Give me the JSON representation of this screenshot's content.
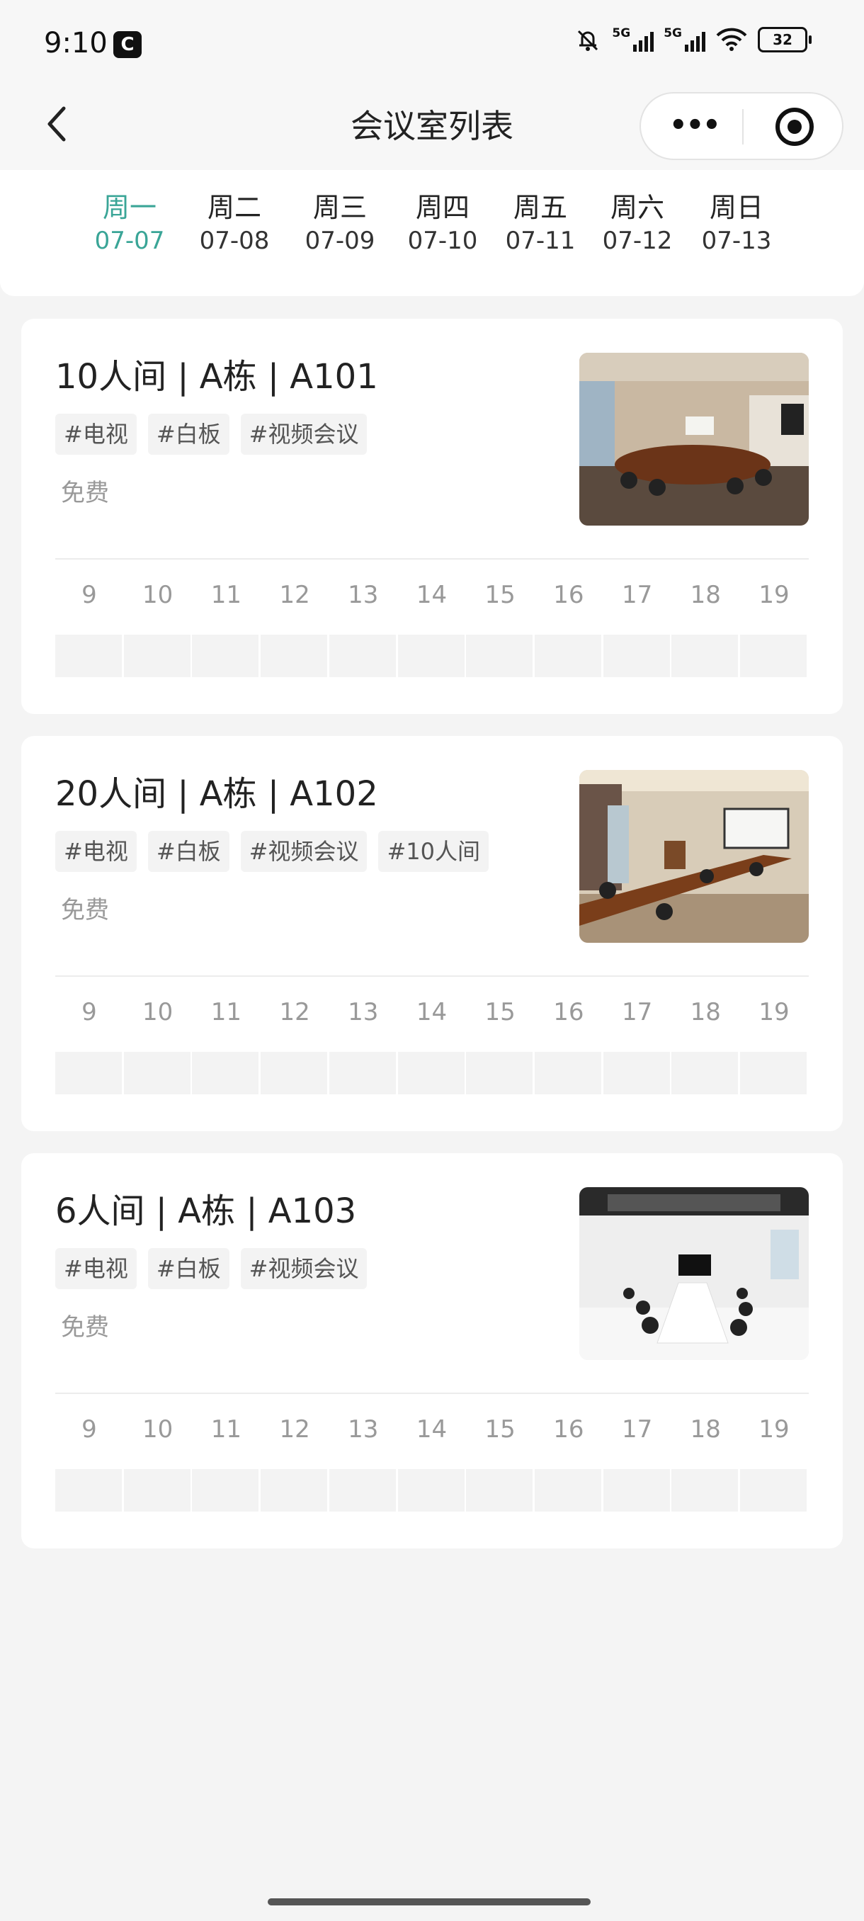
{
  "status_bar": {
    "time": "9:10",
    "app_badge": "C",
    "net1": "5G",
    "net2": "5G",
    "battery": "32"
  },
  "nav": {
    "title": "会议室列表"
  },
  "days": [
    {
      "weekday": "周一",
      "date": "07-07",
      "active": true
    },
    {
      "weekday": "周二",
      "date": "07-08"
    },
    {
      "weekday": "周三",
      "date": "07-09"
    },
    {
      "weekday": "周四",
      "date": "07-10"
    },
    {
      "weekday": "周五",
      "date": "07-11"
    },
    {
      "weekday": "周六",
      "date": "07-12"
    },
    {
      "weekday": "周日",
      "date": "07-13"
    }
  ],
  "rooms": [
    {
      "name": "10人间 | A栋 | A101",
      "tags": [
        "#电视",
        "#白板",
        "#视频会议"
      ],
      "price": "免费"
    },
    {
      "name": "20人间 | A栋 | A102",
      "tags": [
        "#电视",
        "#白板",
        "#视频会议",
        "#10人间"
      ],
      "price": "免费"
    },
    {
      "name": "6人间 | A栋 | A103",
      "tags": [
        "#电视",
        "#白板",
        "#视频会议"
      ],
      "price": "免费"
    }
  ],
  "hours": [
    "9",
    "10",
    "11",
    "12",
    "13",
    "14",
    "15",
    "16",
    "17",
    "18",
    "19"
  ],
  "colors": {
    "accent": "#3aa597",
    "background": "#f4f4f4",
    "card": "#ffffff",
    "slot": "#f3f3f3"
  },
  "icons": {
    "back": "chevron-left-icon",
    "more": "more-dots-icon",
    "close": "target-icon"
  }
}
